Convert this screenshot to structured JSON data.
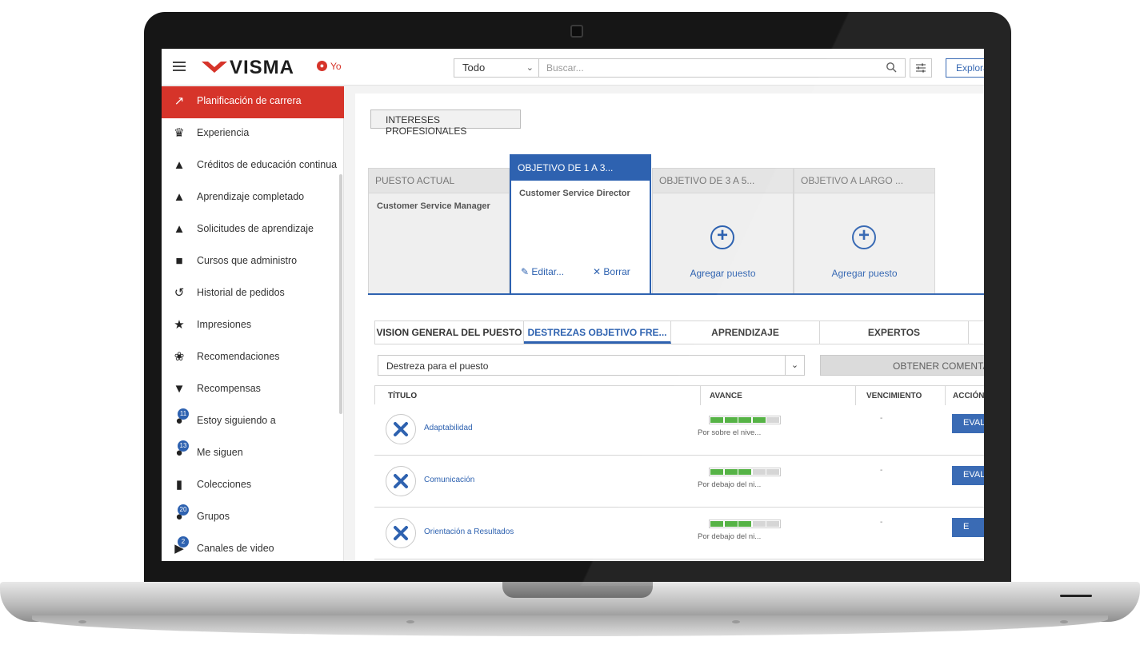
{
  "brand": {
    "name": "VISMA",
    "accent": "#d6342a",
    "primary": "#2e62b0"
  },
  "header": {
    "user_label": "Yo",
    "scope_value": "Todo",
    "search_placeholder": "Buscar...",
    "explore_label": "Explora"
  },
  "sidebar": {
    "items": [
      {
        "label": "Planificación de carrera",
        "icon": "trend-icon",
        "active": true
      },
      {
        "label": "Experiencia",
        "icon": "crown-icon"
      },
      {
        "label": "Créditos de educación continua",
        "icon": "graduation-cap-icon"
      },
      {
        "label": "Aprendizaje completado",
        "icon": "cap-check-icon"
      },
      {
        "label": "Solicitudes de aprendizaje",
        "icon": "cap-clock-icon"
      },
      {
        "label": "Cursos que administro",
        "icon": "book-icon"
      },
      {
        "label": "Historial de pedidos",
        "icon": "history-icon"
      },
      {
        "label": "Impresiones",
        "icon": "star-icon"
      },
      {
        "label": "Recomendaciones",
        "icon": "award-icon"
      },
      {
        "label": "Recompensas",
        "icon": "trophy-icon"
      },
      {
        "label": "Estoy siguiendo a",
        "icon": "following-icon",
        "badge": "11"
      },
      {
        "label": "Me siguen",
        "icon": "followers-icon",
        "badge": "13"
      },
      {
        "label": "Colecciones",
        "icon": "bookmark-icon"
      },
      {
        "label": "Grupos",
        "icon": "group-icon",
        "badge": "20"
      },
      {
        "label": "Canales de video",
        "icon": "video-icon",
        "badge": "2"
      }
    ]
  },
  "career": {
    "interests_label": "INTERESES PROFESIONALES",
    "goals": [
      {
        "head": "PUESTO ACTUAL",
        "role": "Customer Service Manager"
      },
      {
        "head": "OBJETIVO DE 1 A 3...",
        "role": "Customer Service Director",
        "edit": "Editar...",
        "delete": "Borrar"
      },
      {
        "head": "OBJETIVO DE 3 A 5...",
        "add": "Agregar puesto"
      },
      {
        "head": "OBJETIVO A LARGO ...",
        "add": "Agregar puesto"
      }
    ]
  },
  "tabs": [
    "VISION GENERAL DEL PUESTO",
    "DESTREZAS OBJETIVO FRE...",
    "APRENDIZAJE",
    "EXPERTOS"
  ],
  "skills": {
    "select_value": "Destreza para el puesto",
    "feedback_label": "OBTENER COMENTAR",
    "columns": [
      "TÍTULO",
      "AVANCE",
      "VENCIMIENTO",
      "ACCIÓN"
    ],
    "rows": [
      {
        "title": "Adaptabilidad",
        "progress": 0.8,
        "status": "Por sobre el nive...",
        "due": "-",
        "action": "EVAL"
      },
      {
        "title": "Comunicación",
        "progress": 0.6,
        "status": "Por debajo del ni...",
        "due": "-",
        "action": "EVAL"
      },
      {
        "title": "Orientación a Resultados",
        "progress": 0.6,
        "status": "Por debajo del ni...",
        "due": "-",
        "action": "E"
      }
    ],
    "colors": {
      "filled": "#4cae3a",
      "empty": "#d4d4d4"
    }
  }
}
